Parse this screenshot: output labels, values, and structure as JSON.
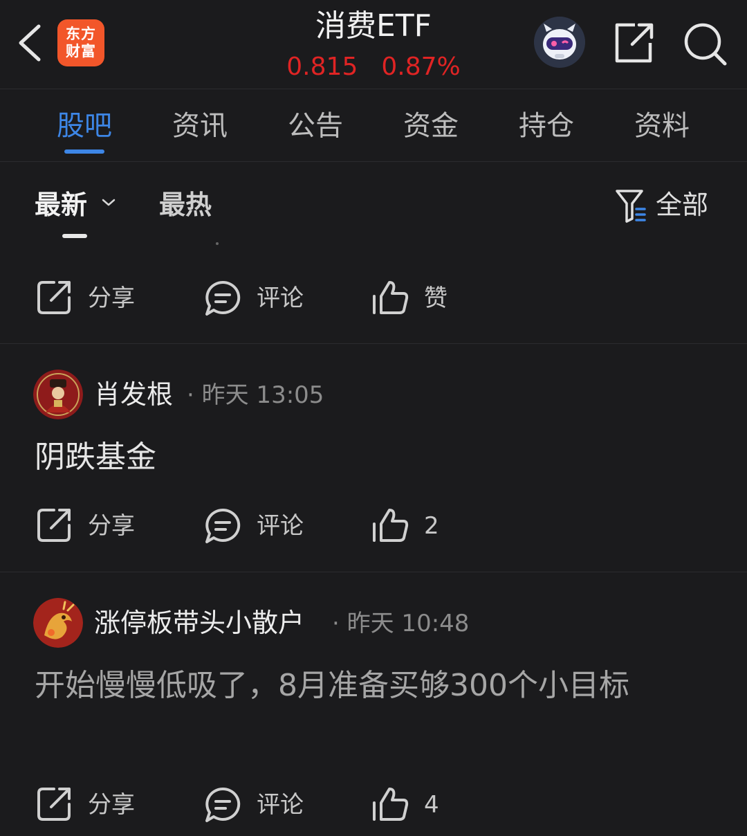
{
  "header": {
    "brand_logo_text": [
      "东方",
      "财富"
    ],
    "title": "消费ETF",
    "price": "0.815",
    "change_pct": "0.87%",
    "icons": [
      "back-arrow-icon",
      "robot-avatar-icon",
      "share-external-icon",
      "search-icon"
    ]
  },
  "tabs": [
    {
      "label": "股吧",
      "active": true
    },
    {
      "label": "资讯",
      "active": false
    },
    {
      "label": "公告",
      "active": false
    },
    {
      "label": "资金",
      "active": false
    },
    {
      "label": "持仓",
      "active": false
    },
    {
      "label": "资料",
      "active": false
    }
  ],
  "sort": {
    "latest": "最新",
    "hot": "最热",
    "filter_label": "全部"
  },
  "actions": {
    "share": "分享",
    "comment": "评论"
  },
  "posts": [
    {
      "like_label": "赞"
    },
    {
      "username": "肖发根",
      "time": "昨天 13:05",
      "content": "阴跌基金",
      "like_label": "2"
    },
    {
      "username": "涨停板带头小散户",
      "time": "昨天 10:48",
      "content": "开始慢慢低吸了，8月准备买够300个小目标",
      "like_label": "4"
    }
  ],
  "colors": {
    "background": "#1b1b1d",
    "accent_blue": "#3d86e6",
    "price_red": "#e02424",
    "brand_orange": "#f2562a"
  }
}
